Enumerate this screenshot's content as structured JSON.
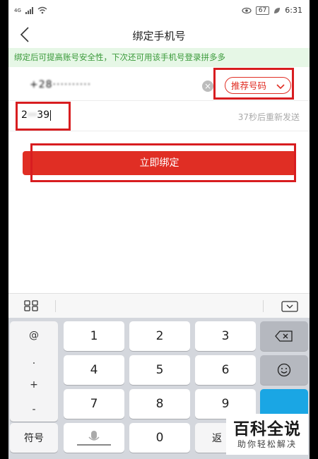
{
  "status": {
    "network": "4G",
    "battery": "67",
    "time": "6:31"
  },
  "nav": {
    "title": "绑定手机号",
    "back_icon": "chevron-left-icon"
  },
  "banner": {
    "text": "绑定后可提高账号安全性，下次还可用该手机号登录拼多多"
  },
  "phone": {
    "value": "+28··········",
    "recommend_label": "推荐号码",
    "clear_label": "×"
  },
  "code": {
    "prefix": "2",
    "middle": "···",
    "suffix": "39",
    "resend": "37秒后重新发送"
  },
  "bind_button": "立即绑定",
  "keyboard": {
    "symbols": [
      "@",
      ".",
      "+",
      "-"
    ],
    "digits": [
      "1",
      "2",
      "3",
      "4",
      "5",
      "6",
      "7",
      "8",
      "9",
      "0"
    ],
    "sym_key": "符号",
    "return_key": "返"
  },
  "colors": {
    "accent": "#e02e24",
    "highlight": "#d81d20",
    "banner_bg": "#e6f7e6",
    "banner_text": "#3a9a3a"
  },
  "watermark": {
    "title": "百科全说",
    "subtitle": "助你轻松解决"
  }
}
